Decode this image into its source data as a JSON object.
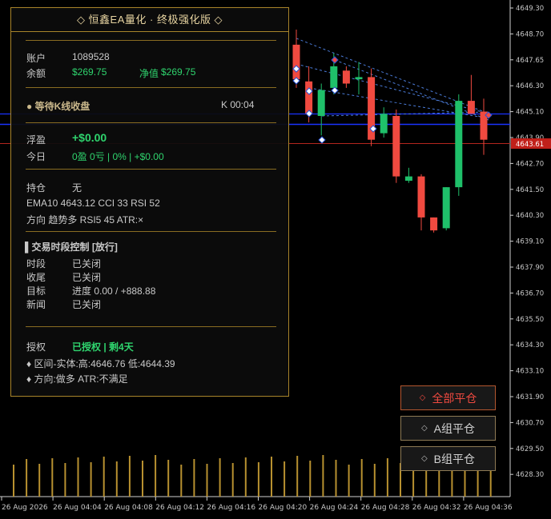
{
  "chart_data": {
    "type": "candlestick",
    "symbol": "EA",
    "y_ticks": [
      "4649.30",
      "4648.70",
      "4647.65",
      "4646.30",
      "4645.10",
      "4643.90",
      "4642.70",
      "4641.50",
      "4640.30",
      "4639.10",
      "4637.90",
      "4636.70",
      "4635.50",
      "4634.30",
      "4633.10",
      "4631.90",
      "4630.70",
      "4629.50",
      "4628.30"
    ],
    "x_ticks": [
      "26 Aug 2026",
      "26 Aug 04:04",
      "26 Aug 04:08",
      "26 Aug 04:12",
      "26 Aug 04:16",
      "26 Aug 04:20",
      "26 Aug 04:24",
      "26 Aug 04:28",
      "26 Aug 04:32",
      "26 Aug 04:36"
    ],
    "price_tag": "4643.61",
    "candles": [
      {
        "o": 4647.6,
        "h": 4648.3,
        "l": 4645.6,
        "c": 4646.0
      },
      {
        "o": 4645.9,
        "h": 4646.6,
        "l": 4644.0,
        "c": 4644.4
      },
      {
        "o": 4644.3,
        "h": 4645.8,
        "l": 4643.4,
        "c": 4645.5
      },
      {
        "o": 4645.6,
        "h": 4647.2,
        "l": 4645.3,
        "c": 4646.6
      },
      {
        "o": 4646.4,
        "h": 4646.6,
        "l": 4645.6,
        "c": 4645.8
      },
      {
        "o": 4646.0,
        "h": 4646.8,
        "l": 4645.3,
        "c": 4646.1
      },
      {
        "o": 4646.1,
        "h": 4646.5,
        "l": 4642.9,
        "c": 4643.2
      },
      {
        "o": 4643.5,
        "h": 4644.7,
        "l": 4643.3,
        "c": 4644.4
      },
      {
        "o": 4644.3,
        "h": 4644.6,
        "l": 4641.2,
        "c": 4641.5
      },
      {
        "o": 4641.3,
        "h": 4641.9,
        "l": 4641.2,
        "c": 4641.5
      },
      {
        "o": 4641.5,
        "h": 4641.6,
        "l": 4639.0,
        "c": 4639.6
      },
      {
        "o": 4639.6,
        "h": 4639.6,
        "l": 4638.9,
        "c": 4639.0
      },
      {
        "o": 4639.1,
        "h": 4641.0,
        "l": 4639.0,
        "c": 4641.0
      },
      {
        "o": 4641.0,
        "h": 4645.3,
        "l": 4640.6,
        "c": 4645.0
      },
      {
        "o": 4645.0,
        "h": 4646.2,
        "l": 4644.4,
        "c": 4644.4
      },
      {
        "o": 4644.5,
        "h": 4645.1,
        "l": 4642.5,
        "c": 4643.2
      }
    ],
    "volumes": [
      1,
      1,
      1,
      1,
      1,
      1,
      1,
      1,
      1,
      1,
      1,
      1,
      1,
      1,
      1,
      1,
      1,
      1,
      1,
      1,
      1,
      1,
      1,
      1,
      1,
      1,
      1,
      1,
      1,
      1,
      1,
      1,
      1,
      1,
      1,
      1,
      1,
      1
    ]
  },
  "panel": {
    "title": "◇ 恒鑫EA量化 · 终极强化版 ◇",
    "account_label": "账户",
    "account_value": "1089528",
    "balance_label": "余额",
    "balance_value": "$269.75",
    "equity_label": "净值",
    "equity_value": "$269.75",
    "status_text": "● 等待K线收盘",
    "k_timer": "K  00:04",
    "float_label": "浮盈",
    "float_value": "+$0.00",
    "today_label": "今日",
    "today_value": "0盈 0亏 | 0% | +$0.00",
    "position_label": "持仓",
    "position_value": "无",
    "indicators_line": "EMA10 4643.12   CCI 33   RSI 52",
    "direction_line": "方向 趋势多   RSI5 45   ATR:×",
    "session_title": "▌交易时段控制  [放行]",
    "rows": [
      {
        "label": "时段",
        "value": "已关闭"
      },
      {
        "label": "收尾",
        "value": "已关闭"
      },
      {
        "label": "目标",
        "value": "进度 0.00 / +888.88"
      },
      {
        "label": "新闻",
        "value": "已关闭"
      }
    ],
    "license_label": "授权",
    "license_value": "已授权 | 剩4天",
    "range_line": "♦ 区间-实体:高:4646.76 低:4644.39",
    "dir_line": "♦ 方向:做多 ATR:不满足"
  },
  "buttons": {
    "close_all": "全部平仓",
    "close_a": "A组平仓",
    "close_b": "B组平仓"
  },
  "colors": {
    "bull": "#1fc06a",
    "bear": "#f04a40",
    "gold": "#a8842a",
    "level_line": "#1a33ff"
  }
}
